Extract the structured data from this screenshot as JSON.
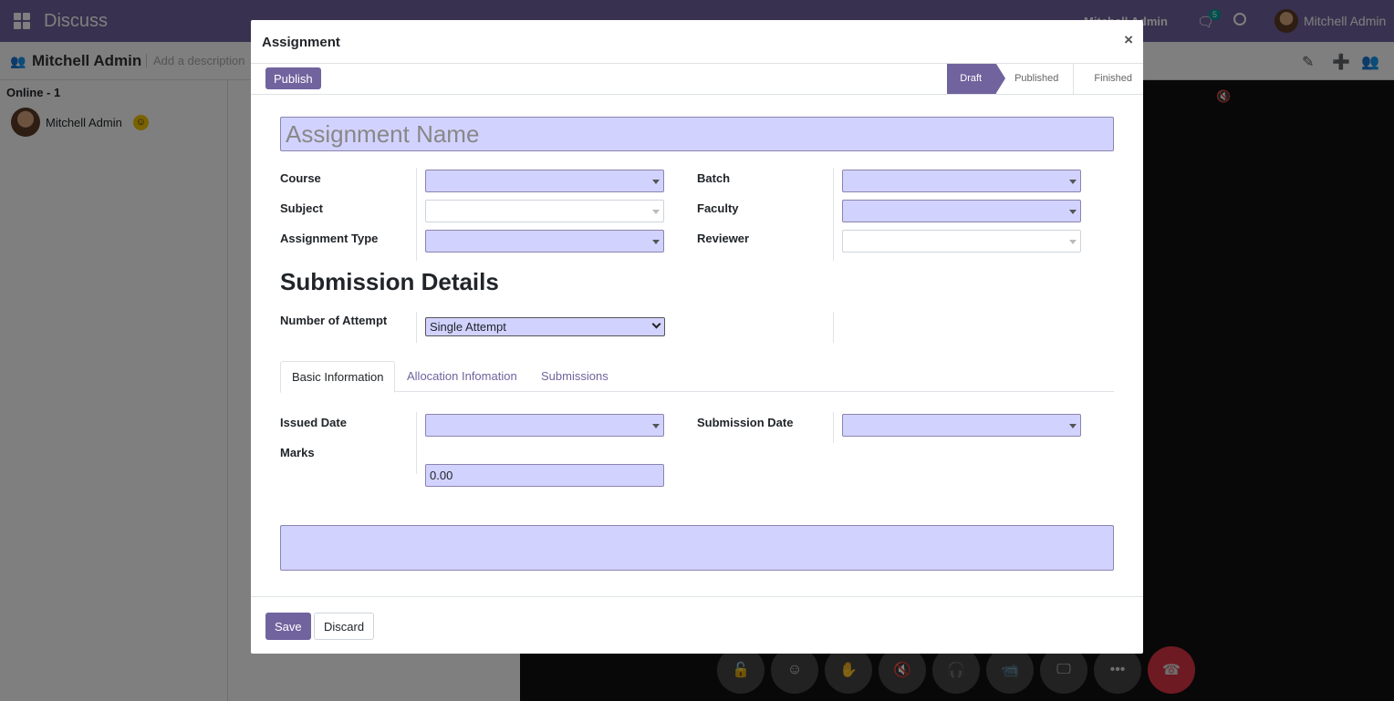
{
  "app": {
    "name": "Discuss",
    "topbar_user_mid": "Mitchell Admin",
    "chat_badge": "5",
    "topbar_user": "Mitchell Admin"
  },
  "channel": {
    "title": "Mitchell Admin",
    "description_placeholder": "Add a description"
  },
  "sidebar": {
    "online_label": "Online - 1",
    "members": [
      {
        "name": "Mitchell Admin"
      }
    ]
  },
  "modal": {
    "title": "Assignment",
    "close_label": "×",
    "publish_label": "Publish",
    "stages": [
      {
        "label": "Draft",
        "active": true
      },
      {
        "label": "Published",
        "active": false
      },
      {
        "label": "Finished",
        "active": false
      }
    ],
    "name_placeholder": "Assignment Name",
    "fields_left": [
      {
        "label": "Course",
        "value": "",
        "required": true
      },
      {
        "label": "Subject",
        "value": "",
        "required": false
      },
      {
        "label": "Assignment Type",
        "value": "",
        "required": true
      }
    ],
    "fields_right": [
      {
        "label": "Batch",
        "value": "",
        "required": true
      },
      {
        "label": "Faculty",
        "value": "",
        "required": true
      },
      {
        "label": "Reviewer",
        "value": "",
        "required": false
      }
    ],
    "section_title": "Submission Details",
    "attempt": {
      "label": "Number of Attempt",
      "selected": "Single Attempt"
    },
    "tabs": [
      {
        "label": "Basic Information",
        "active": true
      },
      {
        "label": "Allocation Infomation",
        "active": false
      },
      {
        "label": "Submissions",
        "active": false
      }
    ],
    "basic": {
      "issued_date_label": "Issued Date",
      "submission_date_label": "Submission Date",
      "marks_label": "Marks",
      "marks_value": "0.00"
    },
    "save_label": "Save",
    "discard_label": "Discard"
  },
  "colors": {
    "brand": "#71639e",
    "required_field": "#d2d2ff",
    "badge": "#00a09d",
    "hangup": "#dc3545"
  }
}
